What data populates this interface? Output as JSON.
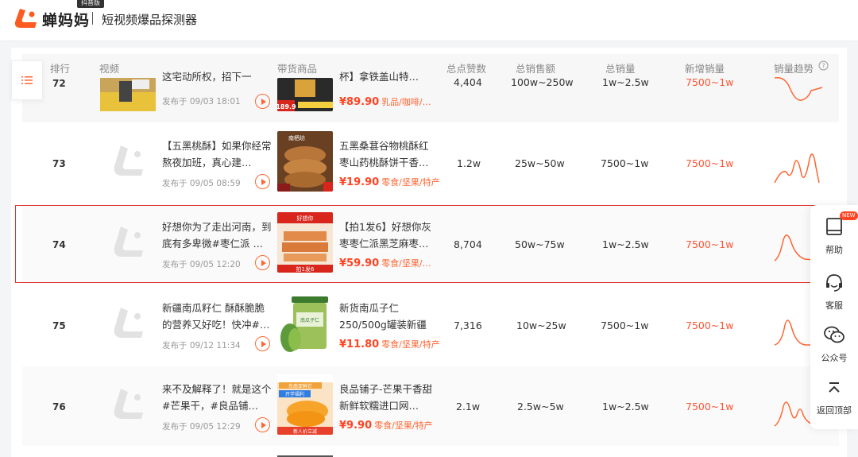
{
  "header": {
    "brand": "蝉妈妈",
    "badge": "抖音版",
    "subtitle": "短视频爆品探测器"
  },
  "table": {
    "columns": [
      "排行",
      "视频",
      "带货商品",
      "总点赞数",
      "总销售额",
      "总销量",
      "新增销量",
      "销量趋势"
    ],
    "rows": [
      {
        "rank": "72",
        "video_title": "这宅动所权，招下一",
        "video_date": "发布于 09/03 18:01",
        "product_title": "杯】拿铁盖山特…",
        "price": "¥89.90",
        "category": "乳品/咖啡/…",
        "likes": "4,404",
        "sales_amount": "100w~250w",
        "sales_volume": "1w~2.5w",
        "new_sales": "7500~1w"
      },
      {
        "rank": "73",
        "video_title": "【五黑桃酥】如果你经常熬夜加班，真心建…",
        "video_date": "发布于 09/05 08:59",
        "product_title": "五黑桑葚谷物桃酥红枣山药桃酥饼干香…",
        "price": "¥19.90",
        "category": "零食/坚果/特产",
        "likes": "1.2w",
        "sales_amount": "25w~50w",
        "sales_volume": "7500~1w",
        "new_sales": "7500~1w"
      },
      {
        "rank": "74",
        "video_title": "好想你为了走出河南，到底有多卑微#枣仁派 …",
        "video_date": "发布于 09/05 12:20",
        "product_title": "【拍1发6】好想你灰枣枣仁派黑芝麻枣…",
        "price": "¥59.90",
        "category": "零食/坚果/…",
        "likes": "8,704",
        "sales_amount": "50w~75w",
        "sales_volume": "1w~2.5w",
        "new_sales": "7500~1w"
      },
      {
        "rank": "75",
        "video_title": "新疆南瓜籽仁 酥酥脆脆的营养又好吃！快冲#…",
        "video_date": "发布于 09/12 11:34",
        "product_title": "新货南瓜子仁250/500g罐装新疆阿勒泰…",
        "price": "¥11.80",
        "category": "零食/坚果/特产",
        "likes": "7,316",
        "sales_amount": "10w~25w",
        "sales_volume": "7500~1w",
        "new_sales": "7500~1w"
      },
      {
        "rank": "76",
        "video_title": "来不及解释了！就是这个#芒果干，#良品铺…",
        "video_date": "发布于 09/05 12:29",
        "product_title": "良品铺子-芒果干香甜新鲜软糯进口网…",
        "price": "¥9.90",
        "category": "零食/坚果/特产",
        "likes": "2.1w",
        "sales_amount": "2.5w~5w",
        "sales_volume": "1w~2.5w",
        "new_sales": "7500~1w"
      }
    ]
  },
  "float_menu": {
    "new_badge": "NEW",
    "items": [
      "帮助",
      "客服",
      "公众号",
      "返回顶部"
    ]
  },
  "product_img_text": {
    "r72_badge": "189.9",
    "r73_brand": "南栖坊",
    "r74_top": "好想你",
    "r74_bottom": "拍1发6",
    "r75_label": "南瓜子仁",
    "r76_top": "东南亚鲜芒",
    "r76_mid": "开学福利",
    "r76_bottom": "新人价立减"
  },
  "colors": {
    "accent": "#ff6633",
    "price": "#ff4422",
    "highlight_border": "#e0352b"
  }
}
